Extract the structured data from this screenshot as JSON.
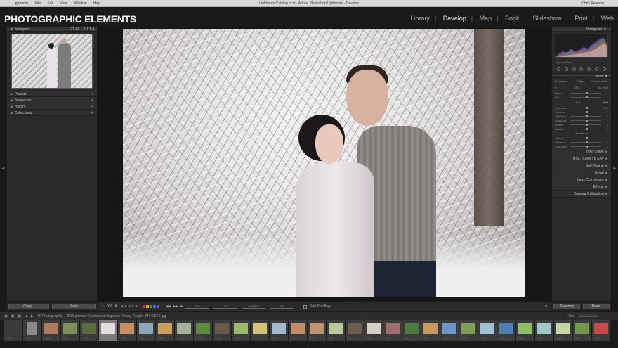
{
  "mac": {
    "app": "Lightroom",
    "menus": [
      "File",
      "Edit",
      "View",
      "Window",
      "Help"
    ],
    "window_title": "Lightroom Catalog.lrcat - Adobe Photoshop Lightroom - Develop",
    "clock": "Chris Pearson"
  },
  "brand": "PHOTOGRAPHIC ELEMENTS",
  "modules": {
    "library": "Library",
    "develop": "Develop",
    "map": "Map",
    "book": "Book",
    "slideshow": "Slideshow",
    "print": "Print",
    "web": "Web",
    "active": "Develop"
  },
  "left_panel": {
    "navigator": {
      "label": "Navigator",
      "zoom_options": "FIT  FILL  1:1  1:4"
    },
    "sections": [
      "Presets",
      "Snapshots",
      "History",
      "Collections"
    ],
    "copy_label": "Copy...",
    "paste_label": "Paste"
  },
  "right_panel": {
    "histogram_label": "Histogram",
    "histogram_info": "Original Photo",
    "basic_label": "Basic",
    "treatment": {
      "label": "Treatment :",
      "color": "Color",
      "bw": "Black & White"
    },
    "wb": {
      "label": "WB :",
      "value": "As Shot"
    },
    "wb_sliders": [
      {
        "label": "Temp",
        "value": ""
      },
      {
        "label": "Tint",
        "value": ""
      }
    ],
    "tone_label": "Tone",
    "auto_label": "Auto",
    "tone_sliders": [
      {
        "label": "Exposure",
        "value": "0.00"
      },
      {
        "label": "Contrast",
        "value": "0"
      },
      {
        "label": "Highlights",
        "value": "0"
      },
      {
        "label": "Shadows",
        "value": "0"
      },
      {
        "label": "Whites",
        "value": "0"
      },
      {
        "label": "Blacks",
        "value": "0"
      }
    ],
    "presence_label": "Presence",
    "presence_sliders": [
      {
        "label": "Clarity",
        "value": "0"
      },
      {
        "label": "Vibrance",
        "value": "0"
      },
      {
        "label": "Saturation",
        "value": "0"
      }
    ],
    "sections": [
      "Tone Curve",
      "HSL / Color / B & W",
      "Split Toning",
      "Detail",
      "Lens Corrections",
      "Effects",
      "Camera Calibration"
    ],
    "previous_label": "Previous",
    "reset_label": "Reset"
  },
  "toolbar": {
    "stars": "★★★★★",
    "flag_colors": [
      "#c23b3b",
      "#d4b02a",
      "#3f9a3a",
      "#3a6fc2",
      "#8a45b8"
    ],
    "color_label": "Color",
    "sliders": [
      "Color",
      "All",
      "None/Gold",
      "Hue"
    ],
    "soft_proofing": "Soft Proofing"
  },
  "filmstrip": {
    "source": "All Photographs",
    "count": "2613 photos / 1 selected / bigstock-Young-Couple-84940524.jpg",
    "filter_label": "Filter :",
    "filter_value": "Filters Off",
    "thumbs": [
      {
        "c": "#3a3a3a",
        "p": true
      },
      {
        "c": "#8a8a8a",
        "p": true
      },
      {
        "c": "#b07a5e",
        "p": false
      },
      {
        "c": "#7e8f5a",
        "p": false
      },
      {
        "c": "#5b6c3e",
        "p": false
      },
      {
        "c": "#e0dcdf",
        "p": false
      },
      {
        "c": "#c58d62",
        "p": false
      },
      {
        "c": "#8ea6b8",
        "p": false
      },
      {
        "c": "#c8a05a",
        "p": false
      },
      {
        "c": "#a7b49a",
        "p": false
      },
      {
        "c": "#5e8a3e",
        "p": false
      },
      {
        "c": "#6a5a4a",
        "p": false
      },
      {
        "c": "#9bba6a",
        "p": false
      },
      {
        "c": "#d8c278",
        "p": false
      },
      {
        "c": "#9fb9cf",
        "p": false
      },
      {
        "c": "#c48a66",
        "p": false
      },
      {
        "c": "#c0946e",
        "p": false
      },
      {
        "c": "#b9c89a",
        "p": false
      },
      {
        "c": "#6d5d4c",
        "p": false
      },
      {
        "c": "#d6d0c8",
        "p": false
      },
      {
        "c": "#a36c6c",
        "p": false
      },
      {
        "c": "#4f7a3d",
        "p": false
      },
      {
        "c": "#c89a5c",
        "p": false
      },
      {
        "c": "#6f94c8",
        "p": false
      },
      {
        "c": "#7da056",
        "p": false
      },
      {
        "c": "#9fc0d6",
        "p": false
      },
      {
        "c": "#4d7fb4",
        "p": false
      },
      {
        "c": "#8dbf6a",
        "p": false
      },
      {
        "c": "#a0c8c8",
        "p": false
      },
      {
        "c": "#c3d8a0",
        "p": false
      },
      {
        "c": "#6f9a4a",
        "p": false
      },
      {
        "c": "#c84a4a",
        "p": false
      }
    ]
  }
}
